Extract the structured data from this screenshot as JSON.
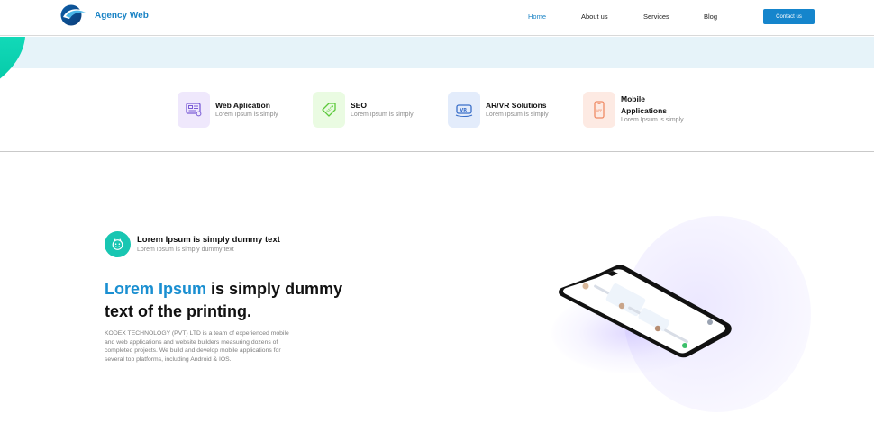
{
  "header": {
    "brand": "Agency Web",
    "nav": [
      "Home",
      "About us",
      "Services",
      "Blog"
    ],
    "active_nav": "Home",
    "contact_label": "Contact us"
  },
  "services": [
    {
      "title": "Web Aplication",
      "subtitle": "Lorem Ipsum is simply",
      "icon": "web-app-icon",
      "bg": "#efe8fc",
      "color": "#7a5cd6"
    },
    {
      "title": "SEO",
      "subtitle": "Lorem Ipsum is simply",
      "icon": "seo-tag-icon",
      "bg": "#eafbe2",
      "color": "#5cc93b"
    },
    {
      "title": "AR/VR Solutions",
      "subtitle": "Lorem Ipsum is simply",
      "icon": "vr-headset-icon",
      "bg": "#e3ecfb",
      "color": "#3a6fc9"
    },
    {
      "title_line1": "Mobile",
      "title_line2": "Applications",
      "subtitle": "Lorem Ipsum is simply",
      "icon": "mobile-app-icon",
      "bg": "#fdeae3",
      "color": "#f08a64"
    }
  ],
  "hero": {
    "badge_title": "Lorem Ipsum is simply dummy text",
    "badge_subtitle": "Lorem Ipsum is simply dummy text",
    "headline_highlight": "Lorem Ipsum",
    "headline_rest": " is simply dummy text of the printing.",
    "description": "KODEX TECHNOLOGY (PVT) LTD is a team of experienced mobile and web applications and website builders measuring dozens of completed projects. We build and develop mobile applications for several top platforms, including Android & IOS."
  },
  "colors": {
    "brand_blue": "#1a83c5",
    "button_blue": "#1585cc",
    "teal_accent": "#18c6b2",
    "banner_bg": "#e6f3f9"
  }
}
